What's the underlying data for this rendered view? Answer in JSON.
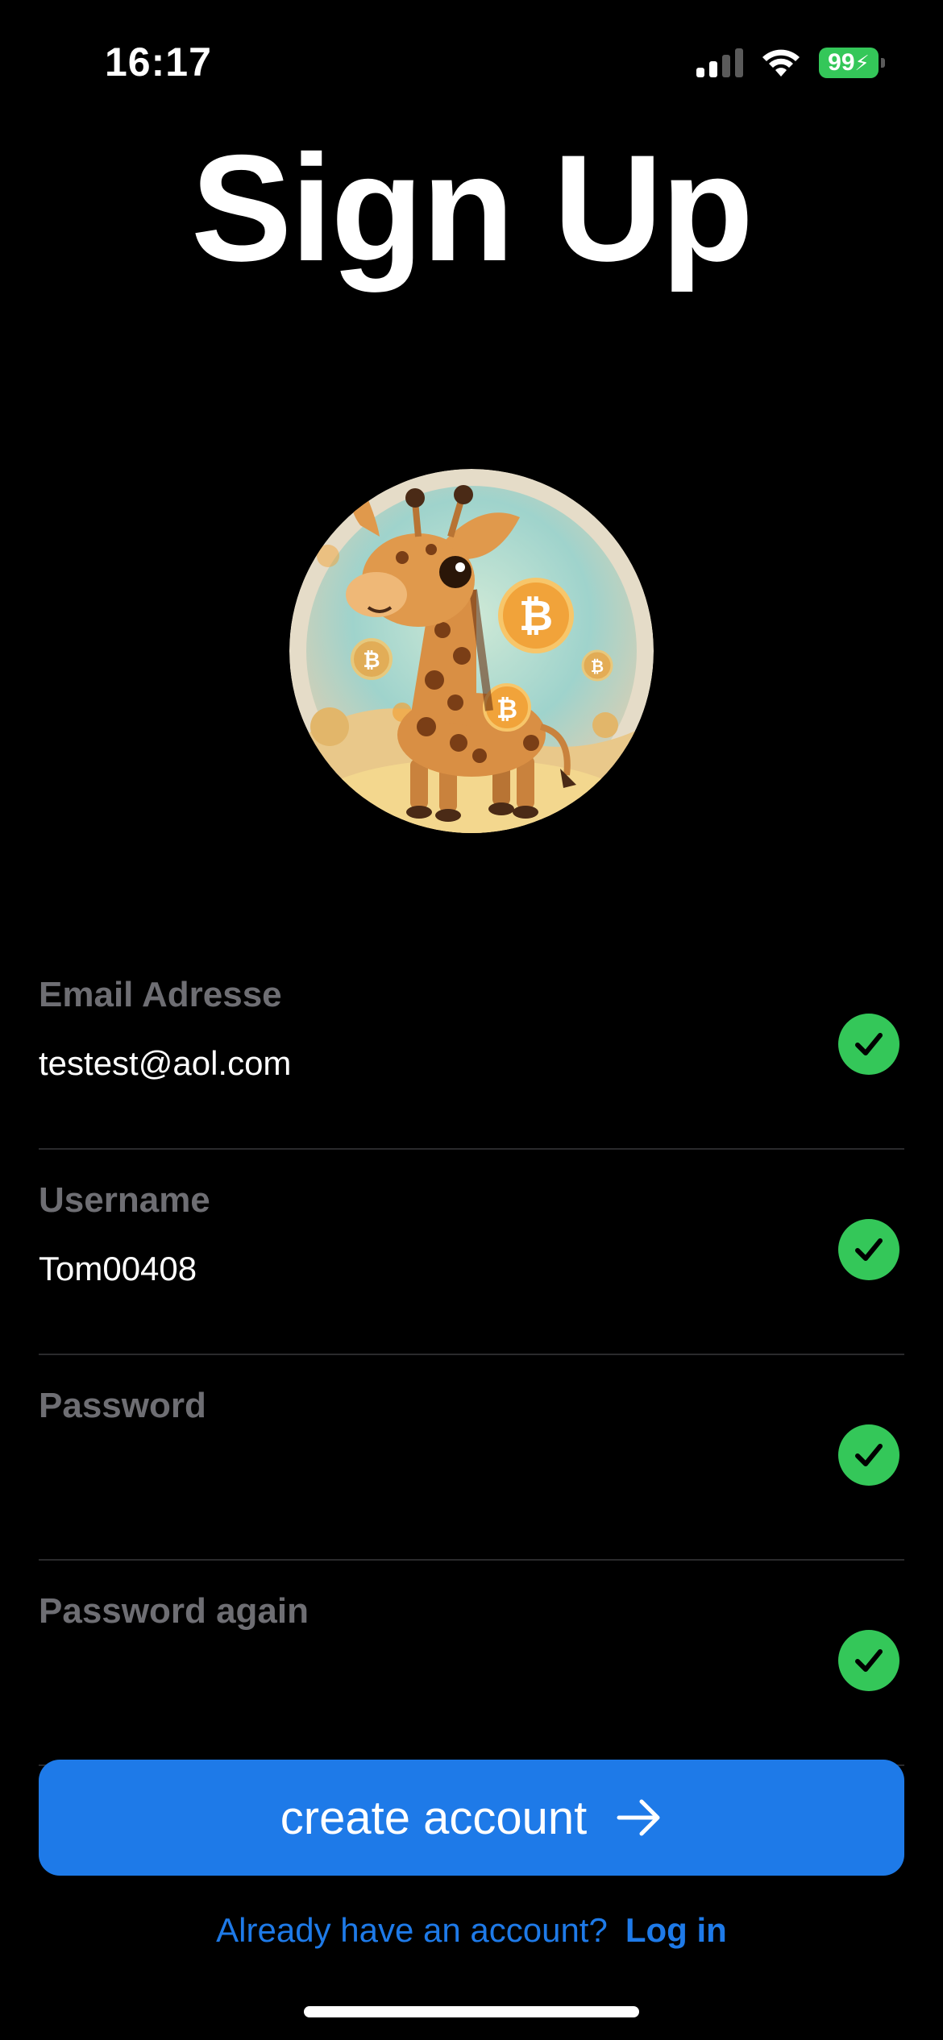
{
  "status_bar": {
    "time": "16:17",
    "battery": "99",
    "icons": [
      "cellular-signal-icon",
      "wifi-icon",
      "battery-charging-icon"
    ]
  },
  "title": "Sign Up",
  "avatar": {
    "icon": "giraffe-bitcoin-avatar"
  },
  "form": {
    "fields": [
      {
        "label": "Email Adresse",
        "value": "testest@aol.com",
        "valid": true
      },
      {
        "label": "Username",
        "value": "Tom00408",
        "valid": true
      },
      {
        "label": "Password",
        "value": "",
        "valid": true
      },
      {
        "label": "Password again",
        "value": "",
        "valid": true
      }
    ]
  },
  "create_button": {
    "label": "create account",
    "icon": "arrow-right-icon"
  },
  "footer": {
    "prompt": "Already have an account?",
    "login_label": "Log in"
  },
  "colors": {
    "background": "#000000",
    "accent": "#1e7ae8",
    "success": "#34c759",
    "label": "#6e6e73"
  }
}
